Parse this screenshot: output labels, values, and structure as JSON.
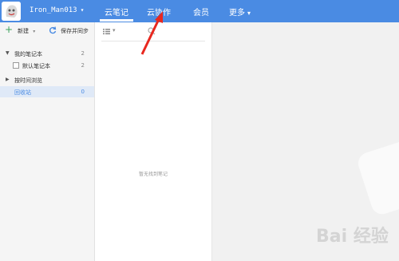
{
  "topbar": {
    "username": "Iron_Man013",
    "tabs": [
      {
        "label": "云笔记"
      },
      {
        "label": "云协作"
      },
      {
        "label": "会员"
      },
      {
        "label": "更多"
      }
    ]
  },
  "sidebar": {
    "new_label": "新建",
    "sync_label": "保存并同步",
    "items": [
      {
        "label": "我的笔记本",
        "count": "2"
      },
      {
        "label": "默认笔记本",
        "count": "2"
      },
      {
        "label": "按时间浏览"
      },
      {
        "label": "回收站",
        "count": "0"
      }
    ]
  },
  "notelist": {
    "empty_message": "暂无找到笔记"
  },
  "watermark": {
    "text": "Bai 经验"
  },
  "colors": {
    "topbar": "#4a8be3",
    "annotation_arrow": "#e8281f"
  }
}
